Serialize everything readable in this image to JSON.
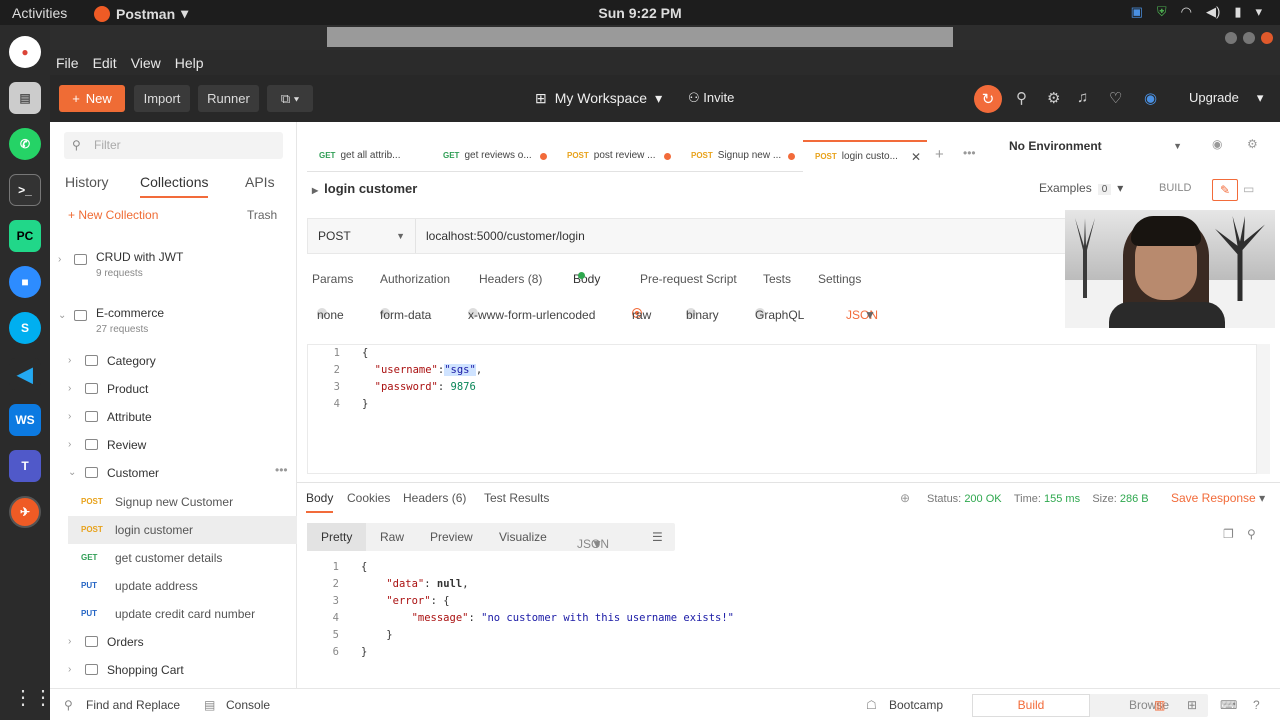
{
  "system": {
    "activities": "Activities",
    "app_name": "Postman",
    "clock": "Sun  9:22 PM"
  },
  "menu": [
    "File",
    "Edit",
    "View",
    "Help"
  ],
  "header": {
    "new_label": "New",
    "import_label": "Import",
    "runner_label": "Runner",
    "workspace": "My Workspace",
    "invite": "Invite",
    "upgrade": "Upgrade"
  },
  "sidebar": {
    "filter_placeholder": "Filter",
    "tabs": [
      "History",
      "Collections",
      "APIs"
    ],
    "new_collection": "+ New Collection",
    "trash": "Trash",
    "collections": [
      {
        "name": "CRUD with JWT",
        "count": "9 requests"
      },
      {
        "name": "E-commerce",
        "count": "27 requests"
      }
    ],
    "folders": [
      "Category",
      "Product",
      "Attribute",
      "Review",
      "Customer"
    ],
    "requests": [
      {
        "method": "POST",
        "name": "Signup new Customer",
        "color": "#e8a21b"
      },
      {
        "method": "POST",
        "name": "login customer",
        "color": "#e8a21b"
      },
      {
        "method": "GET",
        "name": "get customer details",
        "color": "#2f9e55"
      },
      {
        "method": "PUT",
        "name": "update address",
        "color": "#2565c4"
      },
      {
        "method": "PUT",
        "name": "update credit card number",
        "color": "#2565c4"
      }
    ],
    "folders_after": [
      "Orders",
      "Shopping Cart"
    ]
  },
  "tabs": [
    {
      "method": "GET",
      "name": "get all attrib...",
      "color": "#2f9e55",
      "dot": false
    },
    {
      "method": "GET",
      "name": "get reviews o...",
      "color": "#2f9e55",
      "dot": true
    },
    {
      "method": "POST",
      "name": "post review ...",
      "color": "#e8a21b",
      "dot": true
    },
    {
      "method": "POST",
      "name": "Signup new ...",
      "color": "#e8a21b",
      "dot": true
    },
    {
      "method": "POST",
      "name": "login custo...",
      "color": "#e8a21b",
      "dot": false
    }
  ],
  "environment": "No Environment",
  "request": {
    "title": "login customer",
    "examples_label": "Examples",
    "examples_count": "0",
    "build": "BUILD",
    "method": "POST",
    "url": "localhost:5000/customer/login",
    "tabs": {
      "params": "Params",
      "authorization": "Authorization",
      "headers": "Headers (8)",
      "body": "Body",
      "prerequest": "Pre-request Script",
      "tests": "Tests",
      "settings": "Settings"
    },
    "body_types": [
      "none",
      "form-data",
      "x-www-form-urlencoded",
      "raw",
      "binary",
      "GraphQL"
    ],
    "format": "JSON",
    "body_lines": [
      {
        "n": "1",
        "text": "{"
      },
      {
        "n": "2",
        "key": "\"username\"",
        "sep": ":",
        "sel": "\"sgs\"",
        "tail": ","
      },
      {
        "n": "3",
        "key": "\"password\"",
        "sep": ": ",
        "num": "9876"
      },
      {
        "n": "4",
        "text": "}"
      }
    ]
  },
  "response": {
    "tabs": {
      "body": "Body",
      "cookies": "Cookies",
      "headers": "Headers (6)",
      "tests": "Test Results"
    },
    "status_label": "Status:",
    "status_value": "200 OK",
    "time_label": "Time:",
    "time_value": "155 ms",
    "size_label": "Size:",
    "size_value": "286 B",
    "save": "Save Response",
    "views": [
      "Pretty",
      "Raw",
      "Preview",
      "Visualize"
    ],
    "format": "JSON",
    "line_numbers": [
      "1",
      "2",
      "3",
      "4",
      "5",
      "6"
    ],
    "l1": "{",
    "data_key": "\"data\"",
    "data_val": "null",
    "error_key": "\"error\"",
    "message_key": "\"message\"",
    "message_val": "\"no customer with this username exists!\"",
    "l5": "}",
    "l6": "}"
  },
  "statusbar": {
    "find": "Find and Replace",
    "console": "Console",
    "bootcamp": "Bootcamp",
    "build": "Build",
    "browse": "Browse"
  }
}
